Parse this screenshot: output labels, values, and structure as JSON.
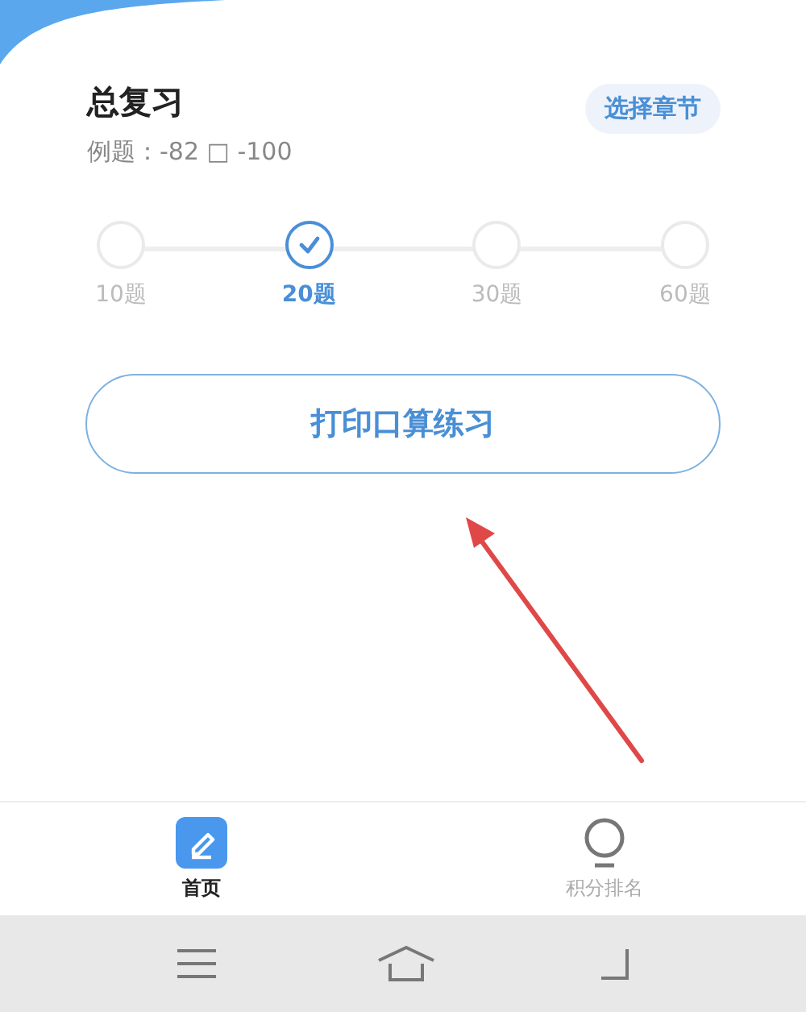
{
  "header": {
    "title": "总复习",
    "example": "例题：-82 □ -100",
    "chapter_button": "选择章节"
  },
  "steps": [
    {
      "label": "10题",
      "selected": false
    },
    {
      "label": "20题",
      "selected": true
    },
    {
      "label": "30题",
      "selected": false
    },
    {
      "label": "60题",
      "selected": false
    }
  ],
  "print_button": "打印口算练习",
  "annotation": {
    "kind": "arrow"
  },
  "tabs": [
    {
      "label": "首页",
      "selected": true,
      "kind": "pencil"
    },
    {
      "label": "积分排名",
      "selected": false,
      "kind": "medal"
    }
  ],
  "system_nav": [
    {
      "kind": "menu"
    },
    {
      "kind": "home"
    },
    {
      "kind": "back"
    }
  ]
}
